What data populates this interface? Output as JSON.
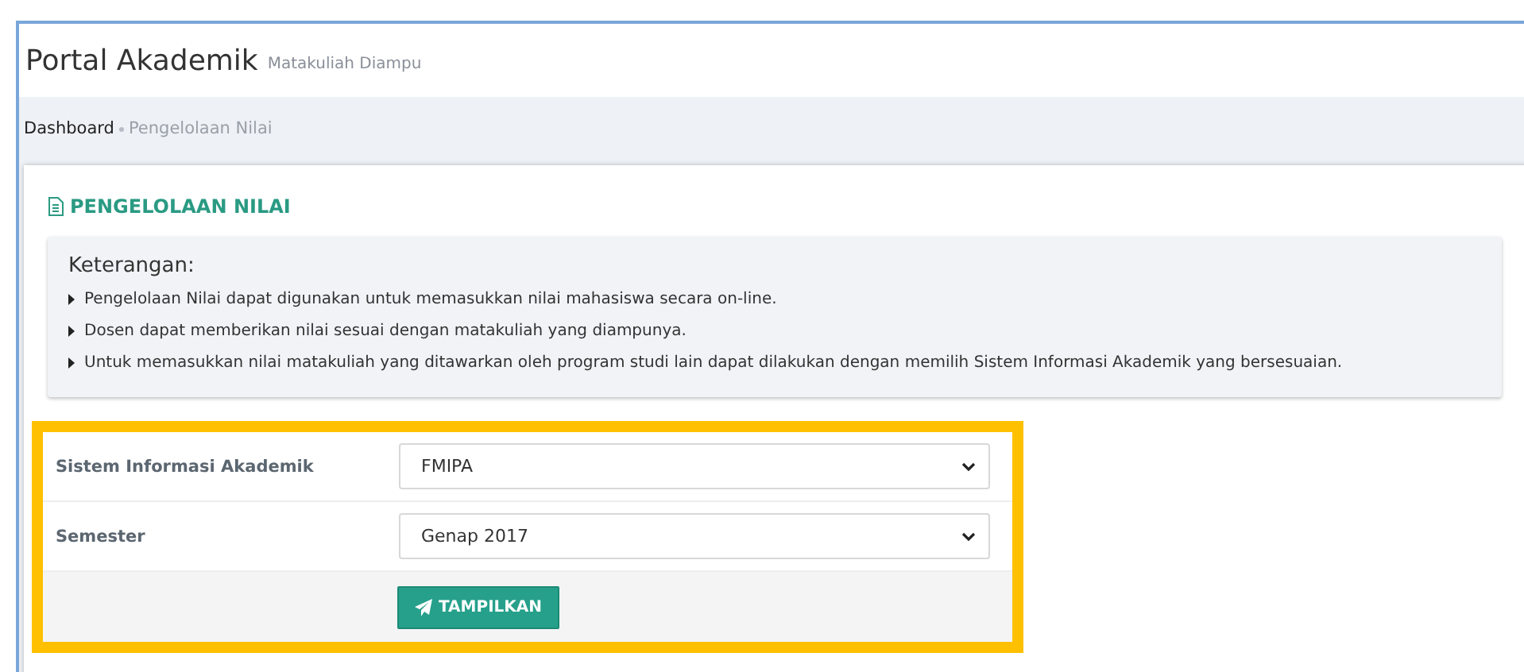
{
  "header": {
    "title": "Portal Akademik",
    "subtitle": "Matakuliah Diampu"
  },
  "breadcrumb": [
    {
      "label": "Dashboard",
      "current": false
    },
    {
      "label": "Pengelolaan Nilai",
      "current": true
    }
  ],
  "section_title": "PENGELOLAAN NILAI",
  "info": {
    "heading": "Keterangan:",
    "items": [
      "Pengelolaan Nilai dapat digunakan untuk memasukkan nilai mahasiswa secara on-line.",
      "Dosen dapat memberikan nilai sesuai dengan matakuliah yang diampunya.",
      "Untuk memasukkan nilai matakuliah yang ditawarkan oleh program studi lain dapat dilakukan dengan memilih Sistem Informasi Akademik yang bersesuaian."
    ]
  },
  "form": {
    "highlighted": true,
    "fields": [
      {
        "label": "Sistem Informasi Akademik",
        "value": "FMIPA"
      },
      {
        "label": "Semester",
        "value": "Genap 2017"
      }
    ],
    "submit": "TAMPILKAN"
  }
}
